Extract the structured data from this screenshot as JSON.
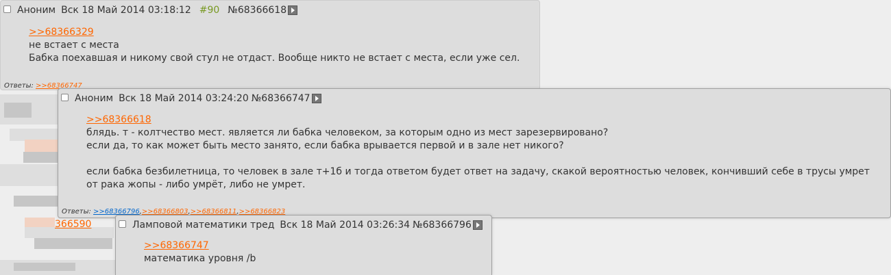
{
  "post1": {
    "name": "Аноним",
    "date": "Вск 18 Май 2014 03:18:12",
    "num": "#90",
    "id": "№68366618",
    "reply_to": ">>68366329",
    "lines": [
      "не встает с места",
      "Бабка поехавшая и никому свой стул не отдаст. Вообще никто не встает с места, если уже сел."
    ],
    "replies_label": "Ответы:",
    "replies": [
      ">>68366747"
    ]
  },
  "post2": {
    "name": "Аноним",
    "date": "Вск 18 Май 2014 03:24:20",
    "id": "№68366747",
    "reply_to": ">>68366618",
    "lines": [
      "блядь. т - колтчество мест. является ли бабка человеком, за которым одно из мест зарезервировано?",
      "если да, то как может быть место занято, если бабка врывается первой и в зале нет никого?",
      "",
      "если бабка безбилетница, то человек в зале т+1б и тогда ответом будет ответ на задачу, скакой вероятностью человек, кончивший себе в трусы умрет от рака жопы - либо умрёт, либо не умрет."
    ],
    "replies_label": "Ответы:",
    "replies": [
      ">>68366796",
      ">>68366803",
      ">>68366811",
      ">>68366823"
    ]
  },
  "post3": {
    "name": "Ламповой математики тред",
    "date": "Вск 18 Май 2014 03:26:34",
    "id": "№68366796",
    "reply_to": ">>68366747",
    "lines": [
      "математика уровня /b"
    ]
  },
  "background": {
    "partial_link": "366590"
  }
}
